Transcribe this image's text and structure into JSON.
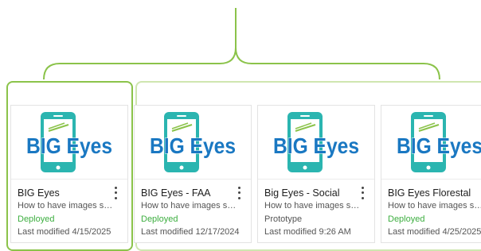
{
  "header": {
    "label": ""
  },
  "colors": {
    "accent_green": "#8bc34a",
    "deployed_green": "#3cae3f",
    "brand_teal": "#2bb5b0",
    "brand_blue": "#1a78c2"
  },
  "cards": [
    {
      "logo_text": "BIG Eyes",
      "title": "BIG Eyes",
      "description": "How to have images sh…",
      "status": "Deployed",
      "modified": "Last modified 4/15/2025"
    },
    {
      "logo_text": "BIG Eyes",
      "title": "BIG Eyes - FAA",
      "description": "How to have images sh…",
      "status": "Deployed",
      "modified": "Last modified 12/17/2024"
    },
    {
      "logo_text": "BIG Eyes",
      "title": "Big Eyes - Social",
      "description": "How to have images sh…",
      "status": "Prototype",
      "modified": "Last modified 9:26 AM"
    },
    {
      "logo_text": "BIG Eyes",
      "title": "BIG Eyes Florestal",
      "description": "How to have images sh…",
      "status": "Deployed",
      "modified": "Last modified 4/25/2025"
    }
  ],
  "icons": {
    "menu": "more-vert-icon",
    "logo": "phone-logo-icon"
  }
}
